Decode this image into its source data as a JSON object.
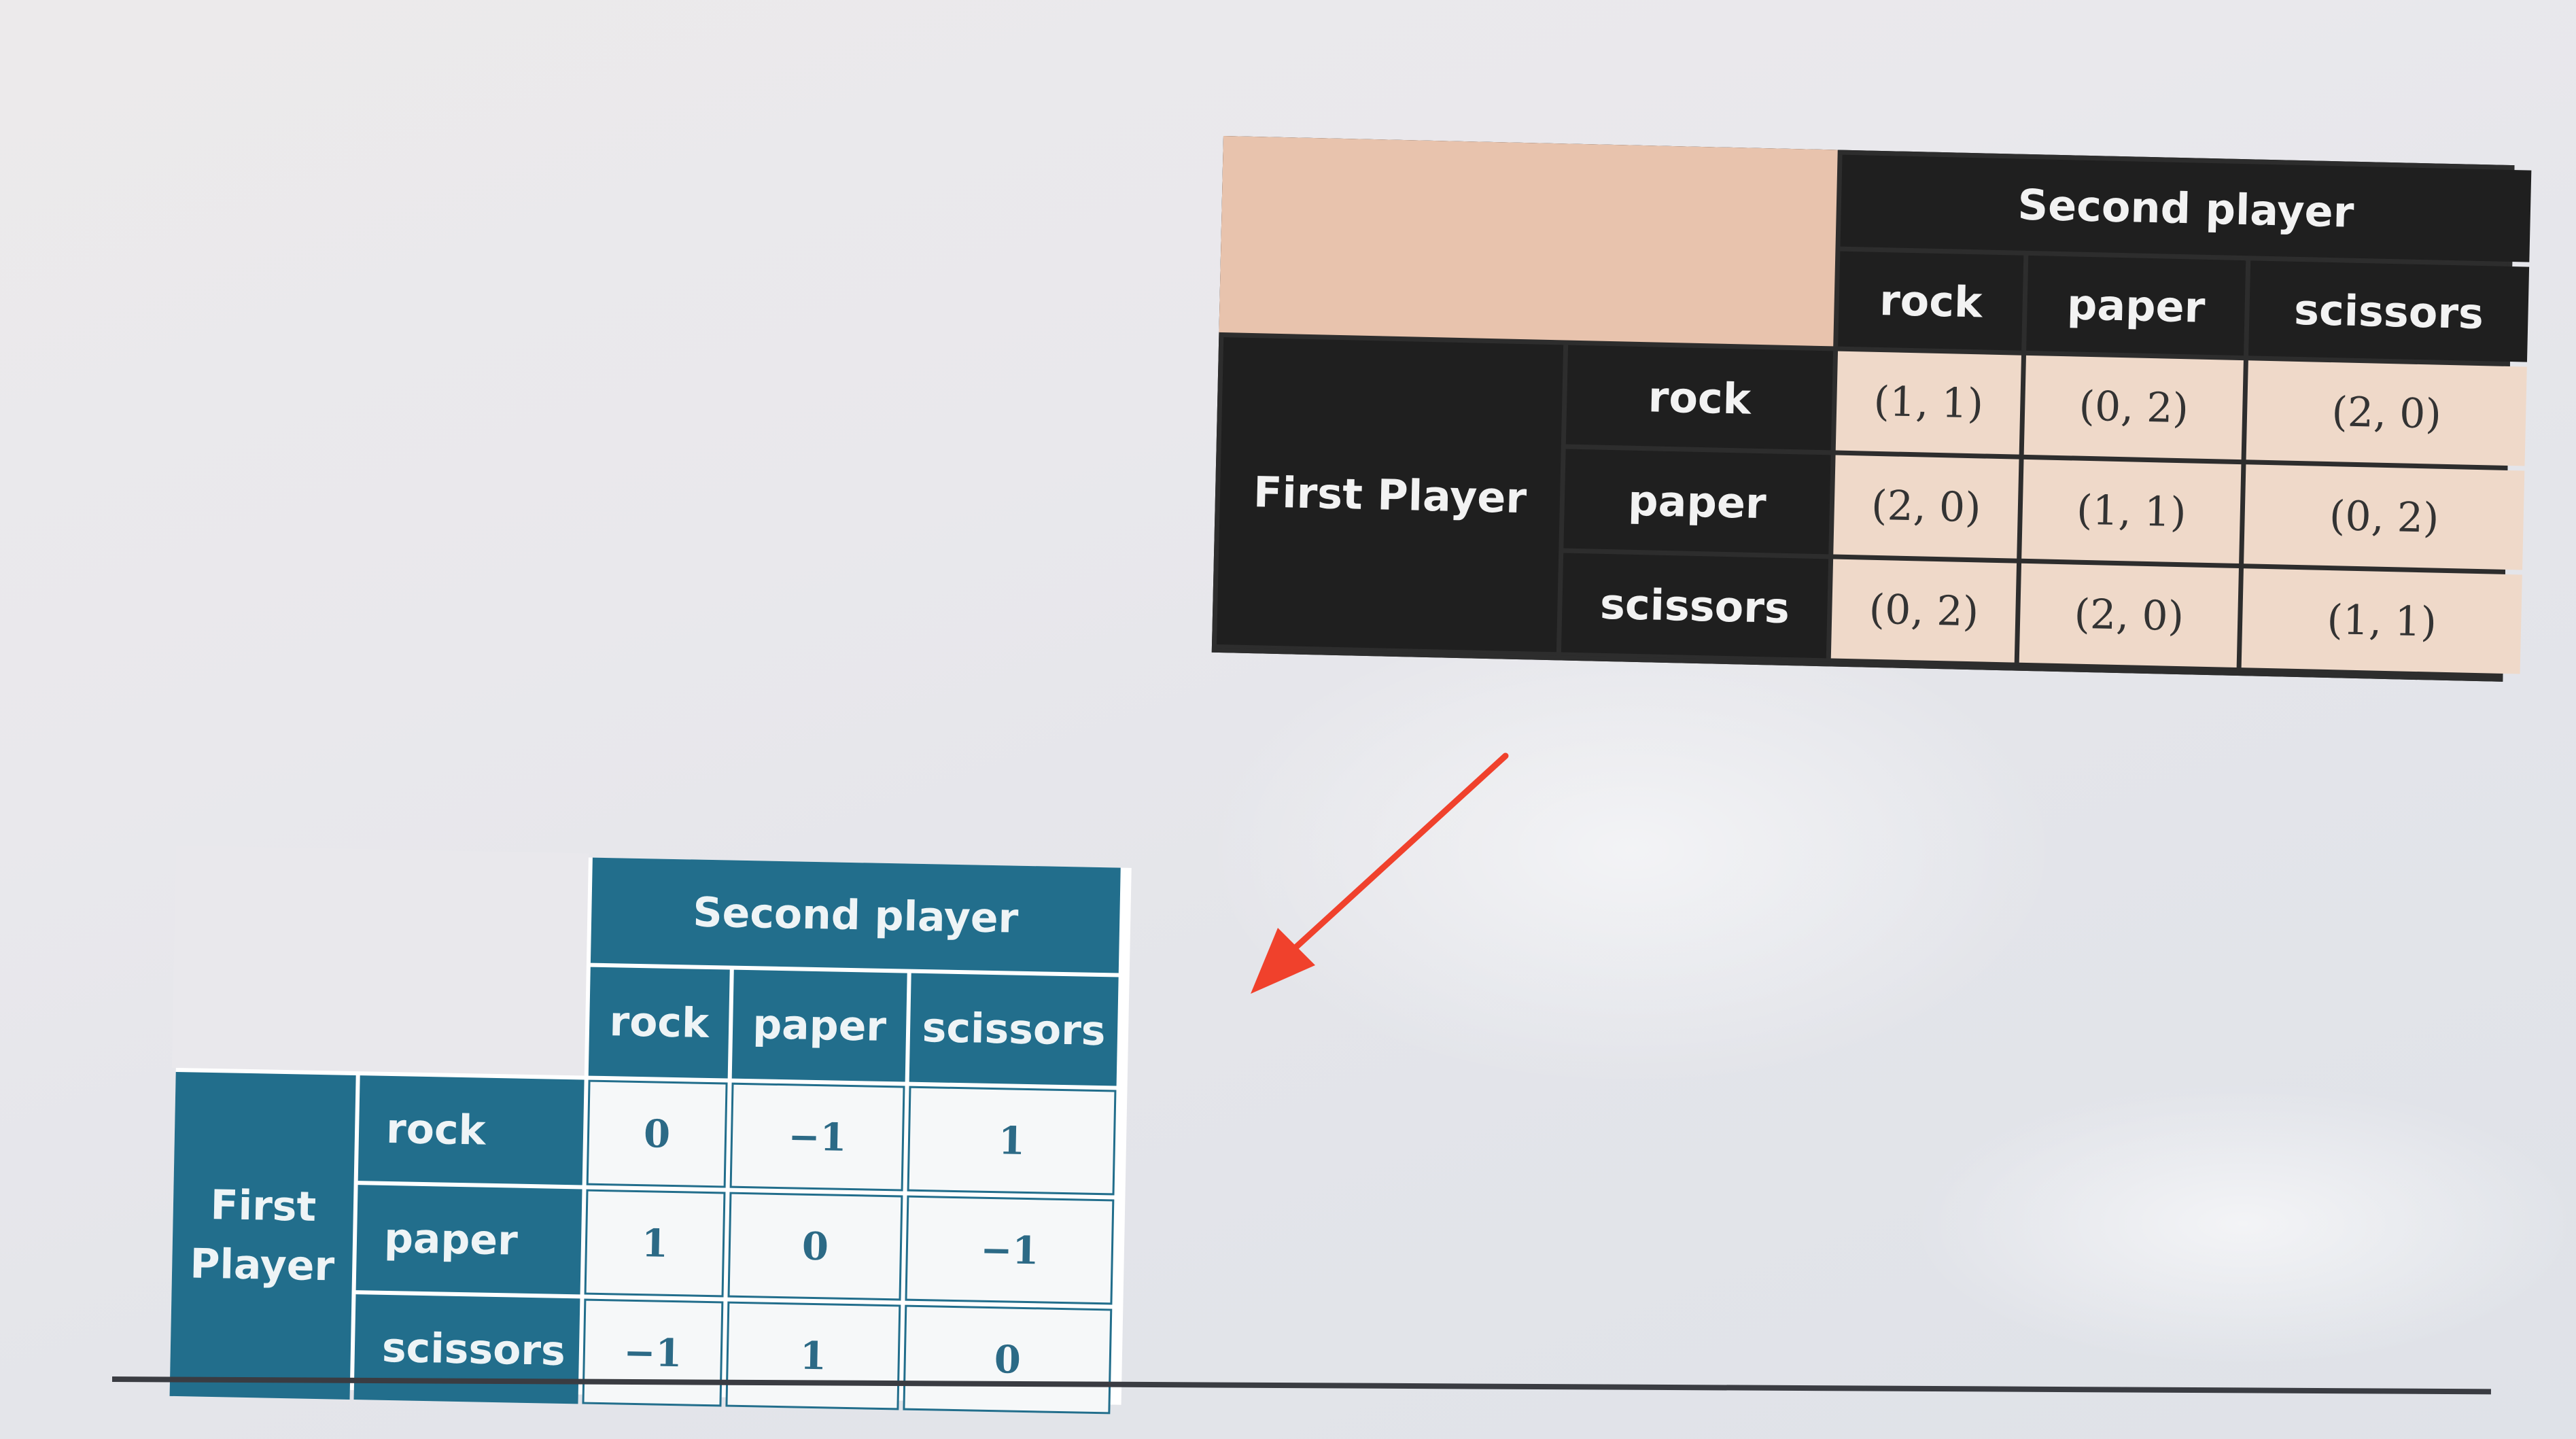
{
  "table_payoff": {
    "column_group_header": "Second player",
    "row_group_header": "First Player",
    "columns": [
      "rock",
      "paper",
      "scissors"
    ],
    "rows": [
      {
        "label": "rock",
        "cells": [
          "(1, 1)",
          "(0, 2)",
          "(2, 0)"
        ]
      },
      {
        "label": "paper",
        "cells": [
          "(2, 0)",
          "(1, 1)",
          "(0, 2)"
        ]
      },
      {
        "label": "scissors",
        "cells": [
          "(0, 2)",
          "(2, 0)",
          "(1, 1)"
        ]
      }
    ],
    "colors": {
      "header_bg": "#1f1f1f",
      "cell_bg": "#efd9c9",
      "corner_bg": "#e8c3ad"
    }
  },
  "table_zero_sum": {
    "column_group_header": "Second player",
    "row_group_header_line1": "First",
    "row_group_header_line2": "Player",
    "columns": [
      "rock",
      "paper",
      "scissors"
    ],
    "rows": [
      {
        "label": "rock",
        "cells": [
          "0",
          "−1",
          "1"
        ]
      },
      {
        "label": "paper",
        "cells": [
          "1",
          "0",
          "−1"
        ]
      },
      {
        "label": "scissors",
        "cells": [
          "−1",
          "1",
          "0"
        ]
      }
    ],
    "colors": {
      "header_bg": "#226e8c",
      "cell_text": "#2c6a86"
    }
  },
  "arrow": {
    "color": "#f0412c",
    "icon": "arrow-down-left-icon"
  }
}
